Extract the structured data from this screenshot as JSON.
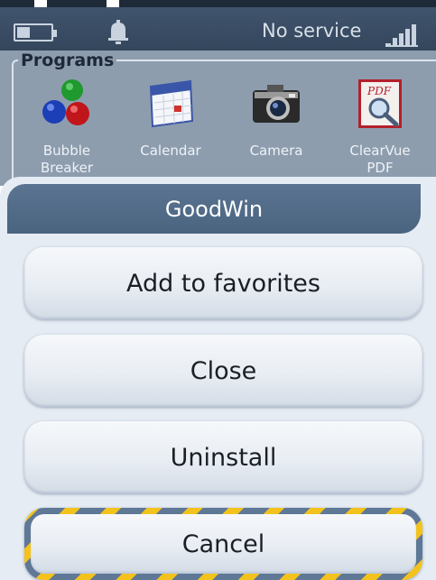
{
  "status_bar": {
    "service_text": "No service",
    "icons": [
      "battery-icon",
      "bell-icon",
      "signal-icon"
    ]
  },
  "programs": {
    "title": "Programs",
    "items": [
      {
        "label": "Bubble Breaker",
        "icon": "bubble-breaker-icon"
      },
      {
        "label": "Calendar",
        "icon": "calendar-icon"
      },
      {
        "label": "Camera",
        "icon": "camera-icon"
      },
      {
        "label": "ClearVue PDF",
        "icon": "pdf-icon"
      }
    ]
  },
  "dialog": {
    "title": "GoodWin",
    "buttons": [
      {
        "label": "Add to favorites"
      },
      {
        "label": "Close"
      },
      {
        "label": "Uninstall"
      },
      {
        "label": "Cancel"
      }
    ]
  },
  "colors": {
    "status_bar": "#3a4d64",
    "programs_bg": "#8d9dae",
    "dialog_header": "#52708e",
    "dialog_bg": "#e6ecf3",
    "cancel_stripe_yellow": "#f3c21c",
    "cancel_stripe_blue": "#5e7896"
  }
}
